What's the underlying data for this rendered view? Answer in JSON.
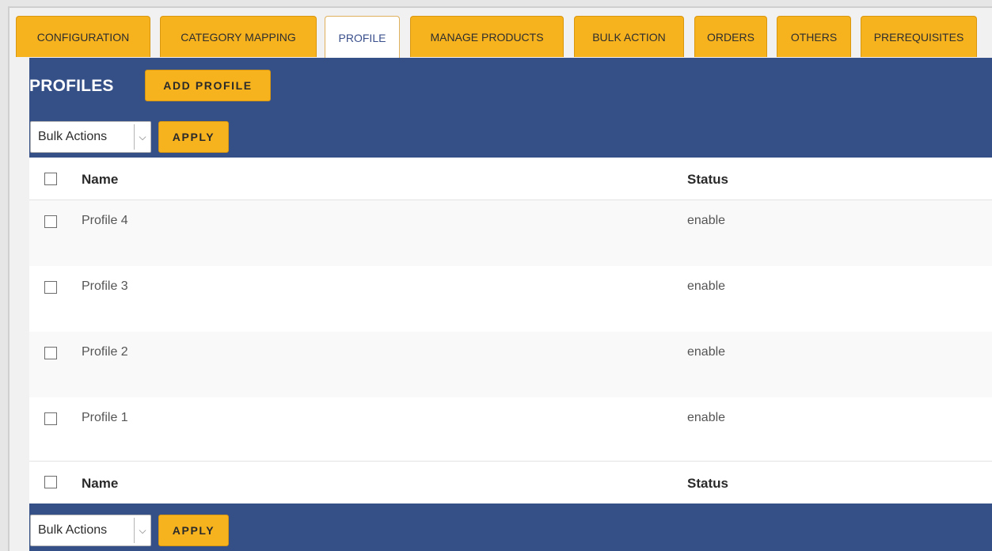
{
  "tabs": [
    {
      "label": "CONFIGURATION",
      "active": false
    },
    {
      "label": "CATEGORY MAPPING",
      "active": false
    },
    {
      "label": "PROFILE",
      "active": true
    },
    {
      "label": "MANAGE PRODUCTS",
      "active": false
    },
    {
      "label": "BULK ACTION",
      "active": false
    },
    {
      "label": "ORDERS",
      "active": false
    },
    {
      "label": "OTHERS",
      "active": false
    },
    {
      "label": "PREREQUISITES",
      "active": false
    }
  ],
  "header": {
    "title": "PROFILES",
    "add_button": "ADD PROFILE"
  },
  "bulk_top": {
    "select_value": "Bulk Actions",
    "apply": "APPLY"
  },
  "bulk_bottom": {
    "select_value": "Bulk Actions",
    "apply": "APPLY"
  },
  "table": {
    "columns": {
      "name": "Name",
      "status": "Status"
    },
    "rows": [
      {
        "name": "Profile 4",
        "status": "enable"
      },
      {
        "name": "Profile 3",
        "status": "enable"
      },
      {
        "name": "Profile 2",
        "status": "enable"
      },
      {
        "name": "Profile 1",
        "status": "enable"
      }
    ]
  },
  "colors": {
    "panel": "#354f87",
    "accent": "#f7b31e"
  },
  "icons": {
    "dropdown": "chevron-down-icon",
    "checkbox": "checkbox-icon"
  }
}
